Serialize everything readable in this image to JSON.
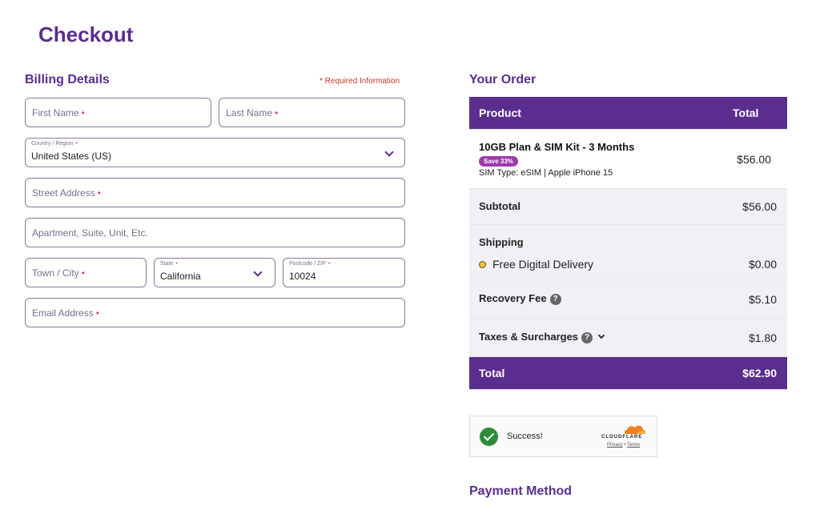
{
  "page": {
    "title": "Checkout"
  },
  "billing": {
    "title": "Billing Details",
    "required_note": "* Required Information",
    "first_name": {
      "placeholder": "First Name",
      "required": "•"
    },
    "last_name": {
      "placeholder": "Last Name",
      "required": "•"
    },
    "country": {
      "label": "Country / Region",
      "required": "•",
      "value": "United States (US)"
    },
    "street": {
      "placeholder": "Street Address",
      "required": "•"
    },
    "apartment": {
      "placeholder": "Apartment, Suite, Unit, Etc."
    },
    "city": {
      "placeholder": "Town / City",
      "required": "•"
    },
    "state": {
      "label": "State",
      "required": "•",
      "value": "California"
    },
    "postcode": {
      "label": "Postcode / ZIP",
      "required": "•",
      "value": "10024"
    },
    "email": {
      "placeholder": "Email Address",
      "required": "•"
    }
  },
  "order": {
    "title": "Your Order",
    "header": {
      "product": "Product",
      "total": "Total"
    },
    "item": {
      "name": "10GB Plan & SIM Kit - 3 Months",
      "badge": "Save 33%",
      "sim_type": "SIM Type:  eSIM | Apple iPhone 15",
      "price": "$56.00"
    },
    "subtotal": {
      "label": "Subtotal",
      "value": "$56.00"
    },
    "shipping": {
      "label": "Shipping",
      "option": "Free Digital Delivery",
      "value": "$0.00"
    },
    "recovery_fee": {
      "label": "Recovery Fee",
      "help": "?",
      "value": "$5.10"
    },
    "taxes": {
      "label": "Taxes & Surcharges",
      "help": "?",
      "value": "$1.80"
    },
    "total": {
      "label": "Total",
      "value": "$62.90"
    }
  },
  "captcha": {
    "status": "Success!",
    "brand": "CLOUDFLARE",
    "privacy": "Privacy",
    "separator": "•",
    "terms": "Terms"
  },
  "payment": {
    "title": "Payment Method"
  },
  "colors": {
    "brand": "#5b2d8e",
    "required": "#c0392b",
    "success": "#2e8b3a",
    "cloudflare": "#f38020"
  }
}
